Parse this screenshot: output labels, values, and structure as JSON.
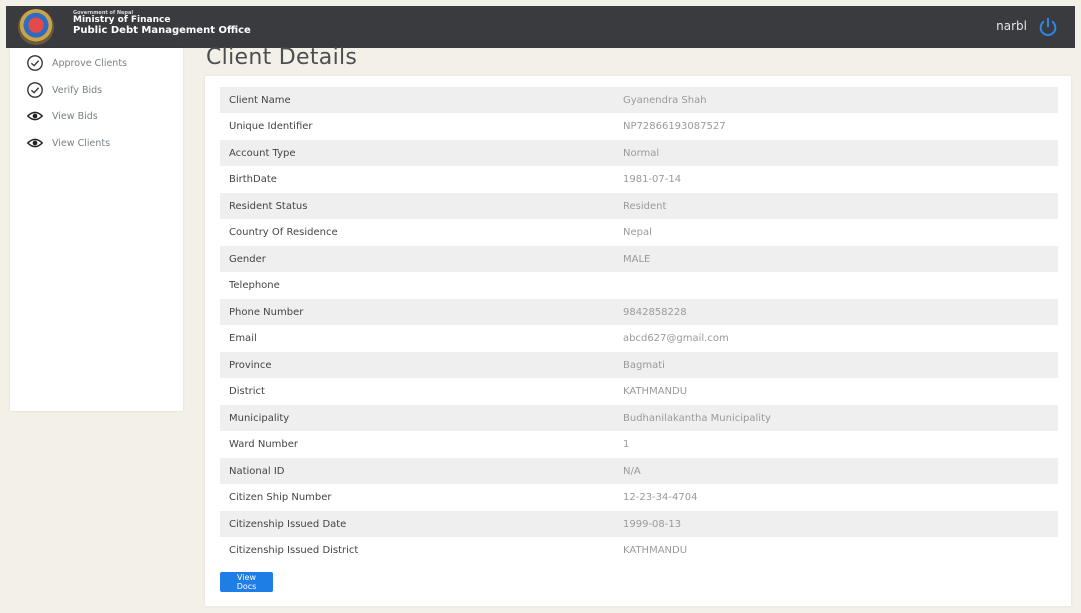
{
  "header": {
    "gov_line": "Government of Nepal",
    "ministry": "Ministry of Finance",
    "office": "Public Debt Management Office",
    "username": "narbl",
    "power_color": "#2f86ea"
  },
  "sidebar": {
    "items": [
      {
        "label": "Approve Clients",
        "icon": "check-circle-icon"
      },
      {
        "label": "Verify Bids",
        "icon": "check-circle-icon"
      },
      {
        "label": "View Bids",
        "icon": "eye-icon"
      },
      {
        "label": "View Clients",
        "icon": "eye-icon"
      }
    ]
  },
  "main": {
    "title": "Client Details",
    "rows": [
      {
        "label": "Client Name",
        "value": "Gyanendra Shah"
      },
      {
        "label": "Unique Identifier",
        "value": "NP72866193087527"
      },
      {
        "label": "Account Type",
        "value": "Normal"
      },
      {
        "label": "BirthDate",
        "value": "1981-07-14"
      },
      {
        "label": "Resident Status",
        "value": "Resident"
      },
      {
        "label": "Country Of Residence",
        "value": "Nepal"
      },
      {
        "label": "Gender",
        "value": "MALE"
      },
      {
        "label": "Telephone",
        "value": ""
      },
      {
        "label": "Phone Number",
        "value": "9842858228"
      },
      {
        "label": "Email",
        "value": "abcd627@gmail.com"
      },
      {
        "label": "Province",
        "value": "Bagmati"
      },
      {
        "label": "District",
        "value": "KATHMANDU"
      },
      {
        "label": "Municipality",
        "value": "Budhanilakantha Municipality"
      },
      {
        "label": "Ward Number",
        "value": "1"
      },
      {
        "label": "National ID",
        "value": "N/A"
      },
      {
        "label": "Citizen Ship Number",
        "value": "12-23-34-4704"
      },
      {
        "label": "Citizenship Issued Date",
        "value": "1999-08-13"
      },
      {
        "label": "Citizenship Issued District",
        "value": "KATHMANDU"
      }
    ],
    "view_docs_label": "View Docs"
  }
}
